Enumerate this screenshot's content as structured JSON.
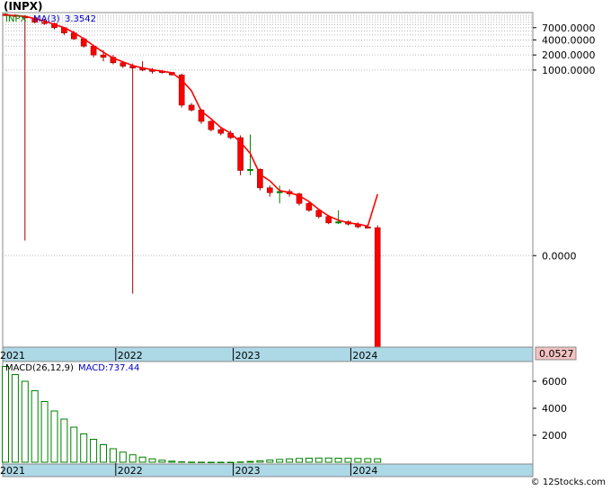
{
  "title": "(INPX)",
  "watermark": "© 12Stocks.com",
  "colors": {
    "up": "#008000",
    "down": "#ff0000",
    "ma": "#ff0000",
    "macd_bar": "#008000",
    "date_strip": "#add8e6",
    "price_badge": "#f4c2c2"
  },
  "price_legend": {
    "symbol": "INPX",
    "ma_label": "MA(3)",
    "ma_value": "3.3542"
  },
  "macd_legend": {
    "params": "MACD(26,12,9)",
    "value_label": "MACD:737.44"
  },
  "last_price": "0.0527",
  "year_labels": [
    "2021",
    "2022",
    "2023",
    "2024"
  ],
  "chart_data": [
    {
      "type": "candlestick",
      "scale": "log",
      "y_tick_labels": [
        "7000.0000",
        "4000.0000",
        "2000.0000",
        "1000.0000",
        "0.0000"
      ],
      "x_tick_labels": [
        "2021",
        "2022",
        "2023",
        "2024"
      ],
      "ma_label": "MA(3)",
      "ma_last": 3.3542,
      "candles": [
        {
          "date": "2021-01",
          "open": 13000,
          "high": 13500,
          "low": 12000,
          "close": 12500
        },
        {
          "date": "2021-02",
          "open": 12500,
          "high": 13000,
          "low": 11500,
          "close": 11800
        },
        {
          "date": "2021-03",
          "open": 11800,
          "high": 12500,
          "low": 0.4,
          "close": 11000
        },
        {
          "date": "2021-04",
          "open": 11000,
          "high": 11500,
          "low": 8500,
          "close": 9000
        },
        {
          "date": "2021-05",
          "open": 9000,
          "high": 10500,
          "low": 8000,
          "close": 8500
        },
        {
          "date": "2021-06",
          "open": 8500,
          "high": 8800,
          "low": 6500,
          "close": 7000
        },
        {
          "date": "2021-07",
          "open": 7000,
          "high": 7200,
          "low": 5000,
          "close": 5500
        },
        {
          "date": "2021-08",
          "open": 5500,
          "high": 6000,
          "low": 4000,
          "close": 4200
        },
        {
          "date": "2021-09",
          "open": 4200,
          "high": 4500,
          "low": 2800,
          "close": 3000
        },
        {
          "date": "2021-10",
          "open": 3000,
          "high": 3200,
          "low": 1800,
          "close": 2000
        },
        {
          "date": "2021-11",
          "open": 2000,
          "high": 2500,
          "low": 1500,
          "close": 1800
        },
        {
          "date": "2021-12",
          "open": 1800,
          "high": 2000,
          "low": 1300,
          "close": 1400
        },
        {
          "date": "2022-01",
          "open": 1400,
          "high": 1500,
          "low": 1100,
          "close": 1200
        },
        {
          "date": "2022-02",
          "open": 1200,
          "high": 1350,
          "low": 0.035,
          "close": 1100
        },
        {
          "date": "2022-03",
          "open": 1100,
          "high": 1500,
          "low": 950,
          "close": 1000
        },
        {
          "date": "2022-04",
          "open": 1000,
          "high": 1100,
          "low": 850,
          "close": 950
        },
        {
          "date": "2022-05",
          "open": 950,
          "high": 1000,
          "low": 850,
          "close": 900
        },
        {
          "date": "2022-06",
          "open": 900,
          "high": 920,
          "low": 780,
          "close": 800
        },
        {
          "date": "2022-07",
          "open": 800,
          "high": 850,
          "low": 180,
          "close": 200
        },
        {
          "date": "2022-08",
          "open": 200,
          "high": 220,
          "low": 150,
          "close": 160
        },
        {
          "date": "2022-09",
          "open": 160,
          "high": 170,
          "low": 85,
          "close": 95
        },
        {
          "date": "2022-10",
          "open": 95,
          "high": 100,
          "low": 60,
          "close": 65
        },
        {
          "date": "2022-11",
          "open": 65,
          "high": 70,
          "low": 50,
          "close": 55
        },
        {
          "date": "2022-12",
          "open": 55,
          "high": 62,
          "low": 42,
          "close": 45
        },
        {
          "date": "2023-01",
          "open": 45,
          "high": 50,
          "low": 8,
          "close": 10
        },
        {
          "date": "2023-02",
          "open": 10,
          "high": 52,
          "low": 8,
          "close": 10.5
        },
        {
          "date": "2023-03",
          "open": 10.5,
          "high": 11,
          "low": 4,
          "close": 4.5
        },
        {
          "date": "2023-04",
          "open": 4.5,
          "high": 5,
          "low": 3,
          "close": 3.6
        },
        {
          "date": "2023-05",
          "open": 3.6,
          "high": 5,
          "low": 2.2,
          "close": 3.8
        },
        {
          "date": "2023-06",
          "open": 3.8,
          "high": 4.2,
          "low": 3.0,
          "close": 3.4
        },
        {
          "date": "2023-07",
          "open": 3.4,
          "high": 3.6,
          "low": 2.0,
          "close": 2.2
        },
        {
          "date": "2023-08",
          "open": 2.2,
          "high": 2.4,
          "low": 1.5,
          "close": 1.6
        },
        {
          "date": "2023-09",
          "open": 1.6,
          "high": 1.7,
          "low": 1.1,
          "close": 1.2
        },
        {
          "date": "2023-10",
          "open": 1.2,
          "high": 1.3,
          "low": 0.85,
          "close": 0.9
        },
        {
          "date": "2023-11",
          "open": 0.9,
          "high": 1.6,
          "low": 0.85,
          "close": 0.95
        },
        {
          "date": "2023-12",
          "open": 0.95,
          "high": 1.0,
          "low": 0.8,
          "close": 0.85
        },
        {
          "date": "2024-01",
          "open": 0.85,
          "high": 0.92,
          "low": 0.7,
          "close": 0.75
        },
        {
          "date": "2024-02",
          "open": 0.75,
          "high": 0.85,
          "low": 0.7,
          "close": 0.72
        },
        {
          "date": "2024-03",
          "open": 0.72,
          "high": 0.8,
          "low": 0.003,
          "close": 0.003
        }
      ]
    },
    {
      "type": "bar",
      "title": "MACD(26,12,9)",
      "legend": "MACD:737.44",
      "y_tick_labels": [
        "6000",
        "4000",
        "2000"
      ],
      "ylim": [
        0,
        7200
      ],
      "values": [
        7100,
        6500,
        6000,
        5300,
        4500,
        3800,
        3200,
        2600,
        2100,
        1700,
        1300,
        1000,
        750,
        550,
        380,
        250,
        150,
        80,
        30,
        10,
        5,
        0,
        0,
        0,
        20,
        60,
        110,
        160,
        210,
        250,
        280,
        300,
        310,
        310,
        300,
        290,
        280,
        270,
        260
      ]
    }
  ]
}
